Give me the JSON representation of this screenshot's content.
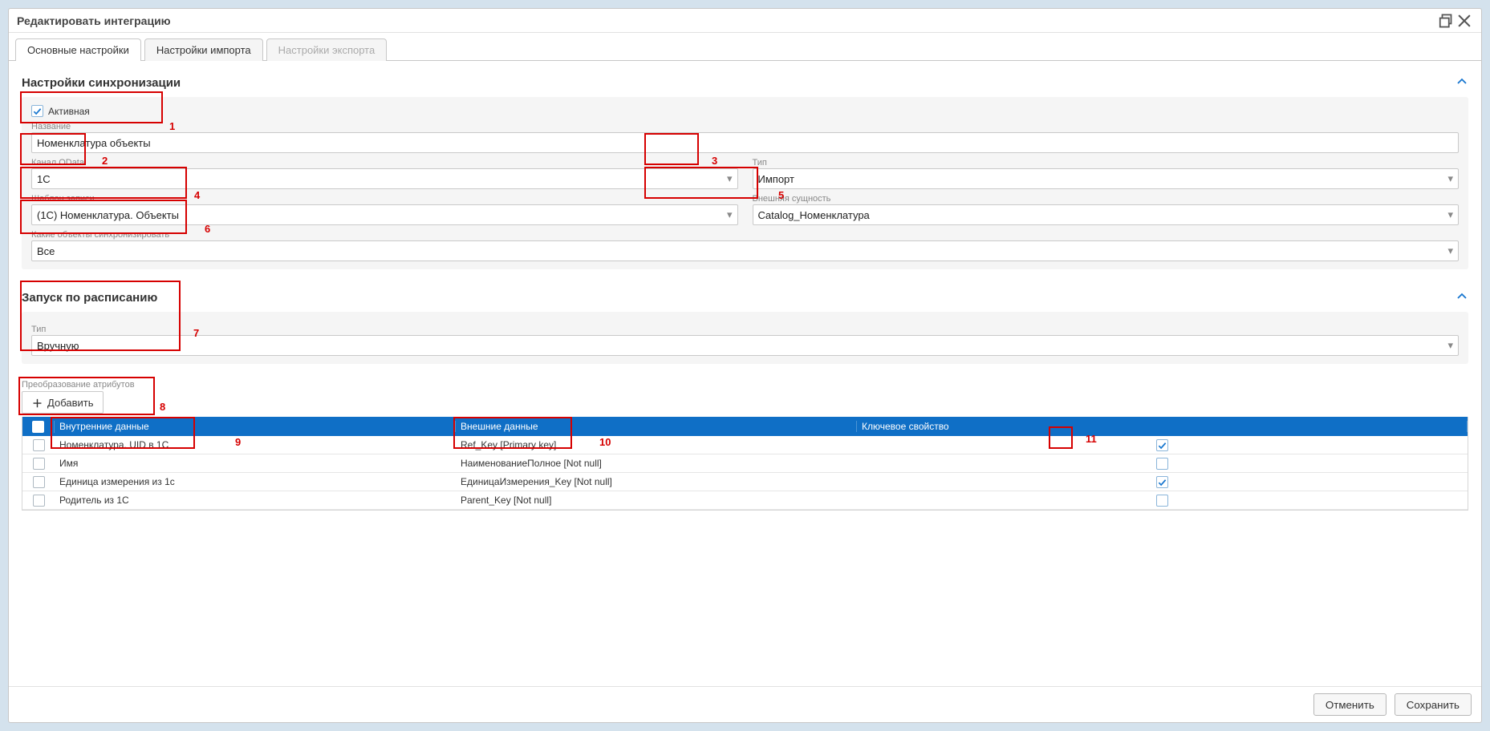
{
  "dialog": {
    "title": "Редактировать интеграцию"
  },
  "tabs": {
    "main": "Основные настройки",
    "import": "Настройки импорта",
    "export": "Настройки экспорта"
  },
  "sync": {
    "section_title": "Настройки синхронизации",
    "active_label": "Активная",
    "name_label": "Название",
    "name_value": "Номенклатура объекты",
    "channel_label": "Канал OData",
    "channel_value": "1C",
    "type_label": "Тип",
    "type_value": "Импорт",
    "template_label": "Шаблон записи",
    "template_value": "(1C) Номенклатура. Объекты",
    "entity_label": "Внешняя сущность",
    "entity_value": "Catalog_Номенклатура",
    "which_label": "Какие объекты синхронизировать",
    "which_value": "Все",
    "annot": {
      "n1": "1",
      "n2": "2",
      "n3": "3",
      "n4": "4",
      "n5": "5",
      "n6": "6"
    }
  },
  "schedule": {
    "section_title": "Запуск по расписанию",
    "type_label": "Тип",
    "type_value": "Вручную",
    "annot": {
      "n7": "7"
    }
  },
  "attrs": {
    "section_label": "Преобразование атрибутов",
    "add_label": "Добавить",
    "annot": {
      "n8": "8",
      "n9": "9",
      "n10": "10",
      "n11": "11"
    },
    "headers": {
      "internal": "Внутренние данные",
      "external": "Внешние данные",
      "key": "Ключевое свойство"
    },
    "rows": [
      {
        "internal": "Номенклатура. UID в 1С",
        "external": "Ref_Key [Primary key]",
        "key": true
      },
      {
        "internal": "Имя",
        "external": "НаименованиеПолное [Not null]",
        "key": false
      },
      {
        "internal": "Единица измерения из 1с",
        "external": "ЕдиницаИзмерения_Key [Not null]",
        "key": true
      },
      {
        "internal": "Родитель из 1С",
        "external": "Parent_Key [Not null]",
        "key": false
      }
    ]
  },
  "footer": {
    "cancel": "Отменить",
    "save": "Сохранить"
  }
}
